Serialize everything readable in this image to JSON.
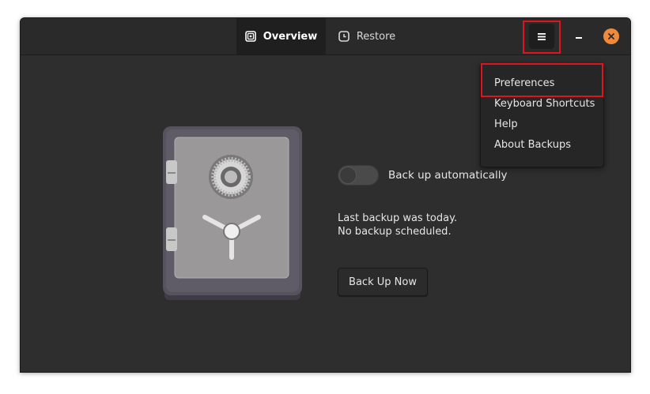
{
  "header": {
    "tabs": [
      {
        "label": "Overview",
        "icon": "overview-icon",
        "active": true
      },
      {
        "label": "Restore",
        "icon": "clock-icon",
        "active": false
      }
    ],
    "menu_icon": "hamburger-menu-icon",
    "minimize_icon": "minimize-icon",
    "close_icon": "close-icon"
  },
  "main": {
    "toggle_label": "Back up automatically",
    "toggle_on": false,
    "status_line1": "Last backup was today.",
    "status_line2": "No backup scheduled.",
    "backup_button": "Back Up Now",
    "illustration_icon": "safe-illustration"
  },
  "menu": {
    "items": [
      {
        "label": "Preferences"
      },
      {
        "label": "Keyboard Shortcuts"
      },
      {
        "label": "Help"
      },
      {
        "label": "About Backups"
      }
    ]
  },
  "colors": {
    "highlight": "#e0141c",
    "close_button": "#f08a3a",
    "window_bg": "#2e2e2e"
  }
}
